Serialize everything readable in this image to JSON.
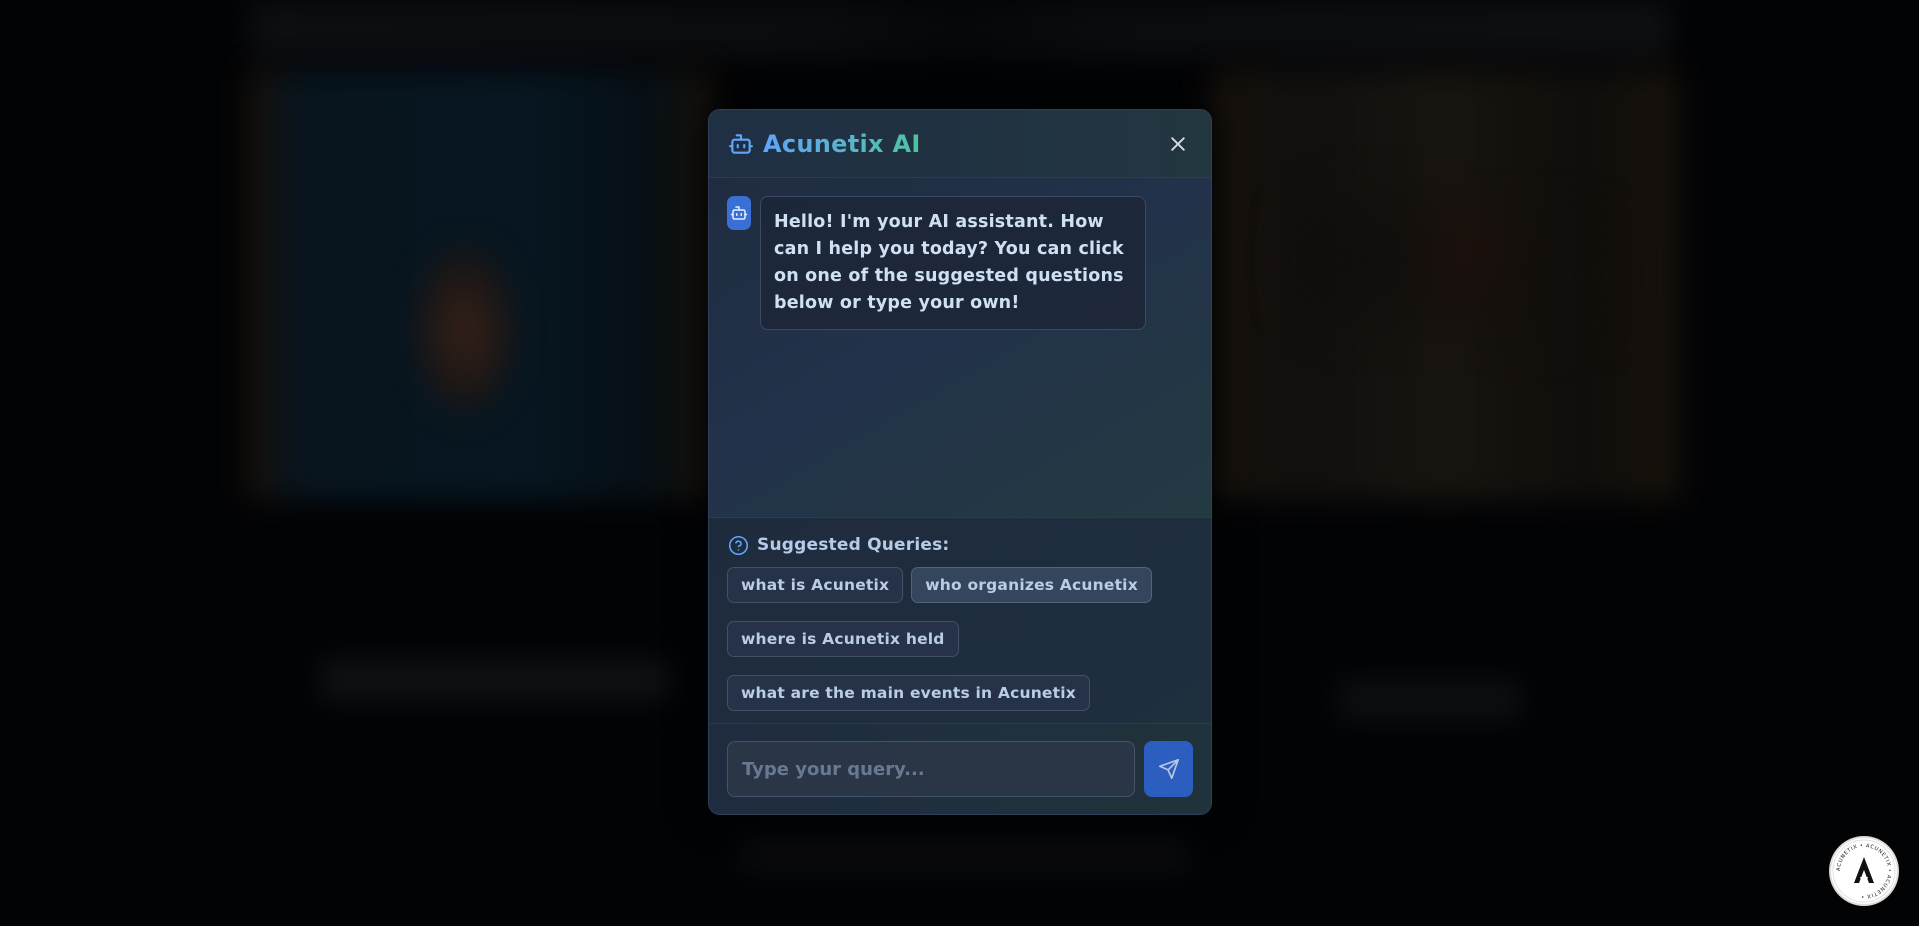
{
  "modal": {
    "title": "Acunetix AI",
    "header_icon": "bot-icon",
    "close_icon": "close-icon"
  },
  "chat": {
    "messages": [
      {
        "sender": "bot",
        "avatar_icon": "bot-icon",
        "text": "Hello! I'm your AI assistant. How can I help you today? You can click on one of the suggested questions below or type your own!"
      }
    ]
  },
  "suggestions": {
    "icon": "question-circle-icon",
    "title": "Suggested Queries:",
    "items": [
      "what is Acunetix",
      "who organizes Acunetix",
      "where is Acunetix held",
      "what are the main events in Acunetix"
    ]
  },
  "input": {
    "placeholder": "Type your query...",
    "value": "",
    "send_icon": "send-icon"
  },
  "badge": {
    "icon": "acunetix-logo-icon",
    "ring_text": "ACUNETIX • ACUNETIX • ACUNETIX •",
    "letter": "A"
  },
  "colors": {
    "accent_blue": "#60a5fa",
    "accent_teal": "#4fc3a1",
    "send_button": "#2c5ec0",
    "avatar": "#3b6fd8"
  }
}
